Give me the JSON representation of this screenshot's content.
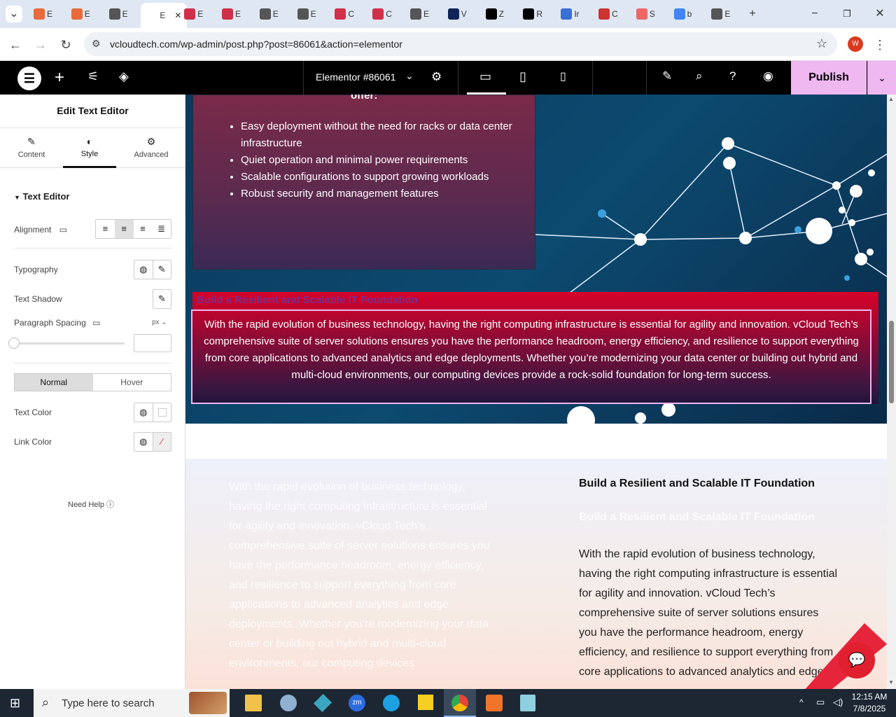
{
  "browser": {
    "tabs": [
      {
        "label": "E",
        "color": "#e86a3a"
      },
      {
        "label": "E",
        "color": "#e86a3a"
      },
      {
        "label": "E",
        "color": "#555"
      },
      {
        "label": "E",
        "color": "#fff",
        "active": true
      },
      {
        "label": "E",
        "color": "#d0304a"
      },
      {
        "label": "E",
        "color": "#d0304a"
      },
      {
        "label": "E",
        "color": "#555"
      },
      {
        "label": "E",
        "color": "#555"
      },
      {
        "label": "C",
        "color": "#d0304a"
      },
      {
        "label": "C",
        "color": "#d0304a"
      },
      {
        "label": "E",
        "color": "#555"
      },
      {
        "label": "V",
        "color": "#10245a"
      },
      {
        "label": "Z",
        "color": "#000"
      },
      {
        "label": "R",
        "color": "#000"
      },
      {
        "label": "Ir",
        "color": "#3a6fd8"
      },
      {
        "label": "C",
        "color": "#c33"
      },
      {
        "label": "S",
        "color": "#e66"
      },
      {
        "label": "b",
        "color": "#4285f4"
      },
      {
        "label": "E",
        "color": "#555"
      }
    ],
    "url": "vcloudtech.com/wp-admin/post.php?post=86061&action=elementor",
    "profile_initial": "W"
  },
  "editor": {
    "doc_title": "Elementor #86061",
    "publish_label": "Publish"
  },
  "panel": {
    "title": "Edit Text Editor",
    "tabs": {
      "content": "Content",
      "style": "Style",
      "advanced": "Advanced"
    },
    "section": "Text Editor",
    "alignment": "Alignment",
    "typography": "Typography",
    "text_shadow": "Text Shadow",
    "paragraph_spacing": "Paragraph Spacing",
    "unit": "px",
    "normal": "Normal",
    "hover": "Hover",
    "text_color": "Text Color",
    "link_color": "Link Color",
    "need_help": "Need Help"
  },
  "canvas": {
    "offer_fragment": "offer:",
    "bullets": [
      "Easy deployment without the need for racks or data center infrastructure",
      "Quiet operation and minimal power requirements",
      "Scalable configurations to support growing workloads",
      "Robust security and management features"
    ],
    "red_heading": "Build a Resilient and Scalable IT Foundation",
    "red_paragraph": "With the rapid evolution of business technology, having the right computing infrastructure is essential for agility and innovation. vCloud Tech’s comprehensive suite of server solutions ensures you have the performance headroom, energy efficiency, and resilience to support everything from core applications to advanced analytics and edge deployments. Whether you’re modernizing your data center or building out hybrid and multi-cloud environments, our computing devices provide a rock-solid foundation for long-term success.",
    "left_faded": "With the rapid evolution of business technology, having the right computing infrastructure is essential for agility and innovation. vCloud Tech’s comprehensive suite of server solutions ensures you have the performance headroom, energy efficiency, and resilience to support everything from core applications to advanced analytics and edge deployments. Whether you’re modernizing your data center or building out hybrid and multi-cloud environments, our computing devices",
    "right_heading": "Build a Resilient and Scalable IT Foundation",
    "right_heading_faded": "Build a Resilient and Scalable IT Foundation",
    "right_paragraph": "With the rapid evolution of business technology, having the right computing infrastructure is essential for agility and innovation. vCloud Tech’s comprehensive suite of server solutions ensures you have the performance headroom, energy efficiency, and resilience to support everything from core applications to advanced analytics and edge"
  },
  "taskbar": {
    "search_placeholder": "Type here to search",
    "time": "12:15 AM",
    "date": "7/8/2025"
  }
}
